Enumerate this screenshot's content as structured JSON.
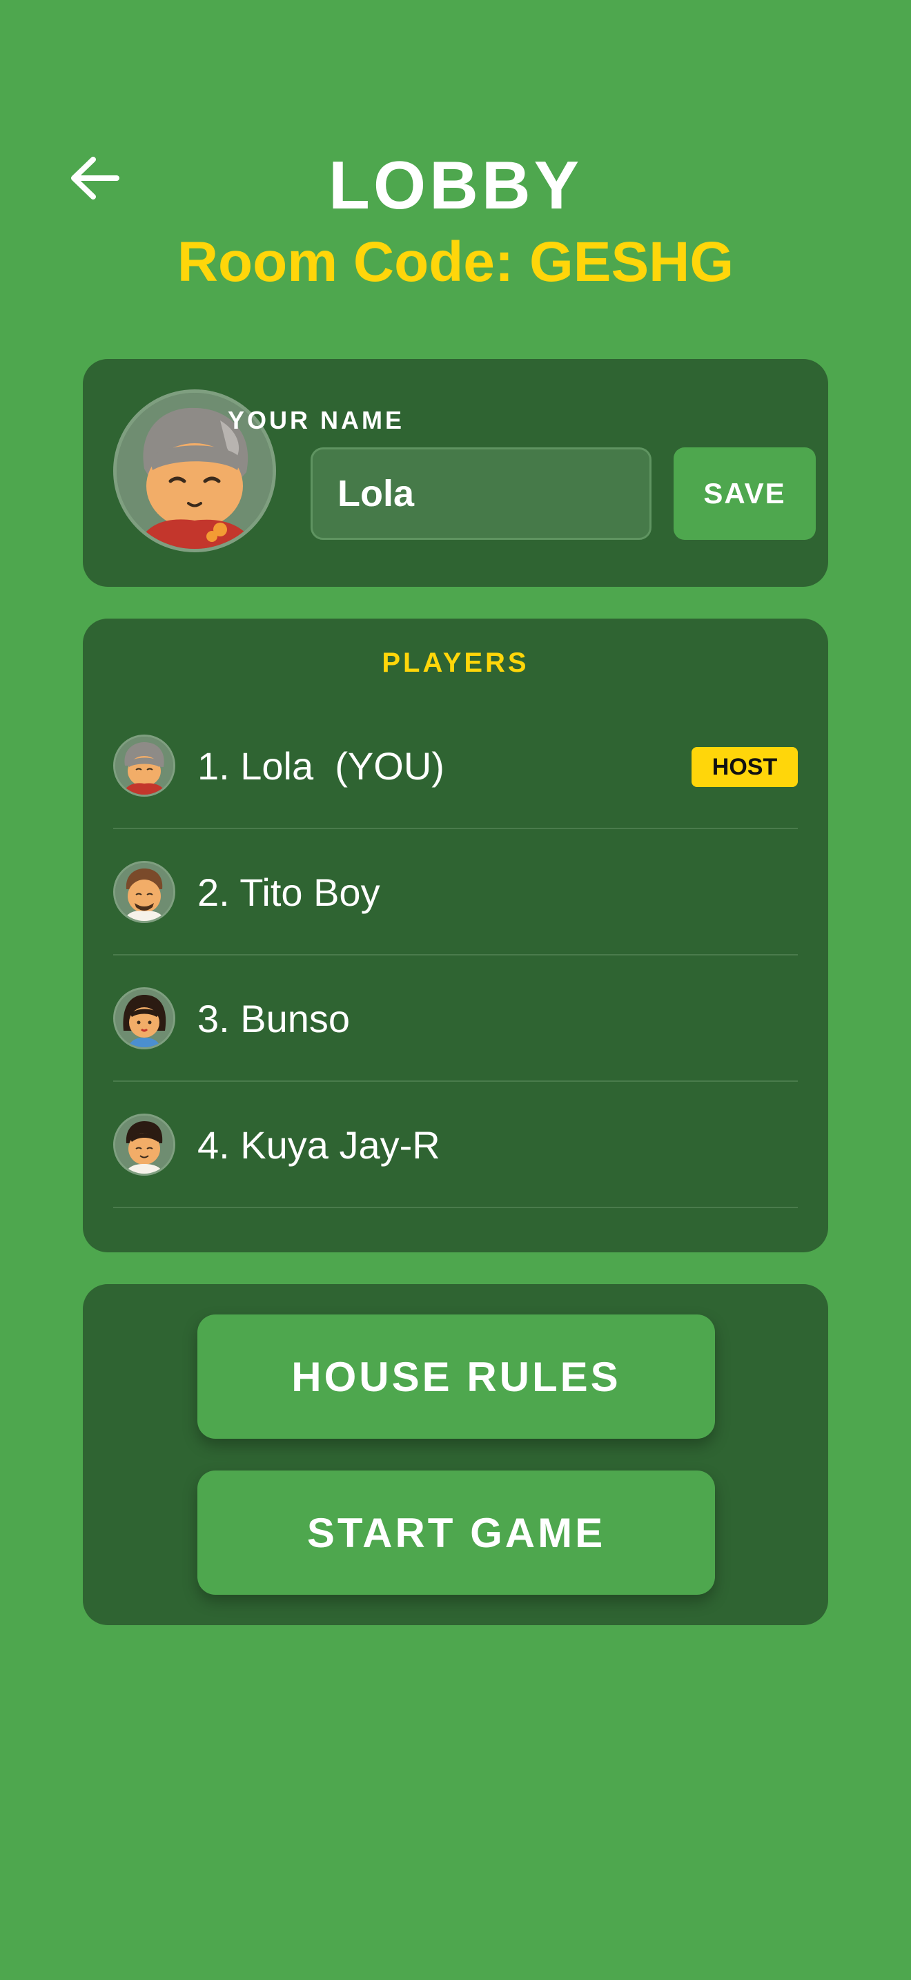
{
  "header": {
    "back_icon": "arrow-left-icon",
    "title": "LOBBY",
    "room_code": "Room Code: GESHG"
  },
  "profile": {
    "avatar_icon": "grandma-avatar",
    "name_label": "YOUR NAME",
    "name_value": "Lola",
    "save_label": "SAVE"
  },
  "players": {
    "heading": "PLAYERS",
    "list": [
      {
        "name": "1. Lola  (YOU)",
        "avatar": "grandma-avatar",
        "badge": "HOST"
      },
      {
        "name": "2. Tito Boy",
        "avatar": "uncle-avatar"
      },
      {
        "name": "3. Bunso",
        "avatar": "girl-avatar"
      },
      {
        "name": "4. Kuya Jay-R",
        "avatar": "boy-avatar"
      }
    ]
  },
  "actions": {
    "house_rules_label": "HOUSE RULES",
    "start_game_label": "START GAME"
  },
  "colors": {
    "background": "#4ea74e",
    "panel": "#2f6432",
    "accent_yellow": "#ffd60a",
    "button_green": "#4ea74e"
  }
}
